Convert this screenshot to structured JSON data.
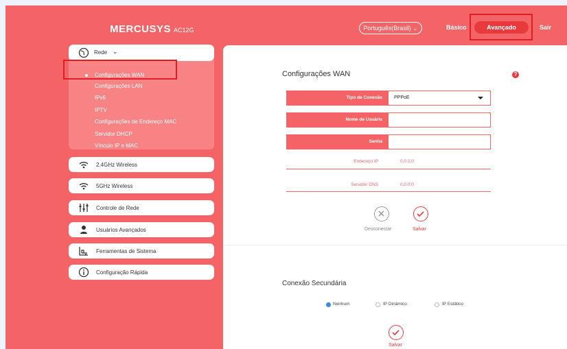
{
  "header": {
    "brand": "MERCUSYS",
    "model": "AC12G",
    "language": "Português(Brasil)",
    "nav_basic": "Básico",
    "nav_advanced": "Avançado",
    "nav_exit": "Sair"
  },
  "sidebar": {
    "network_group": {
      "label": "Rede",
      "items": [
        {
          "label": "Configurações WAN",
          "active": true
        },
        {
          "label": "Configurações LAN"
        },
        {
          "label": "IPv6"
        },
        {
          "label": "IPTV"
        },
        {
          "label": "Configurações de Endereço MAC"
        },
        {
          "label": "Servidor DHCP"
        },
        {
          "label": "Vínculo IP e MAC"
        }
      ]
    },
    "items": [
      {
        "label": "2.4GHz Wireless",
        "icon": "wifi-icon"
      },
      {
        "label": "5GHz Wireless",
        "icon": "wifi-icon"
      },
      {
        "label": "Controle de Rede",
        "icon": "sliders-icon"
      },
      {
        "label": "Usuários Avançados",
        "icon": "user-icon"
      },
      {
        "label": "Ferramentas de Sistema",
        "icon": "tools-icon"
      },
      {
        "label": "Configuração Rápida",
        "icon": "info-icon"
      }
    ]
  },
  "wan": {
    "title": "Configurações WAN",
    "help": "?",
    "connection_type_label": "Tipo de Conexão",
    "connection_type_value": "PPPoE",
    "username_label": "Nome de Usuário",
    "username_value": "",
    "password_label": "Senha",
    "password_value": "",
    "ip_label": "Endereço IP",
    "ip_value": "0.0.0.0",
    "dns_label": "Servidor DNS",
    "dns_value": "0.0.0.0",
    "disconnect_label": "Desconectar",
    "save_label": "Salvar"
  },
  "secondary": {
    "title": "Conexão Secundária",
    "options": [
      "Nenhum",
      "IP Dinâmico",
      "IP Estático"
    ],
    "selected": "Nenhum",
    "save_label": "Salvar"
  },
  "colors": {
    "brand": "#f46466",
    "accent": "#e83a3c",
    "highlight_box": "#e01d22"
  }
}
